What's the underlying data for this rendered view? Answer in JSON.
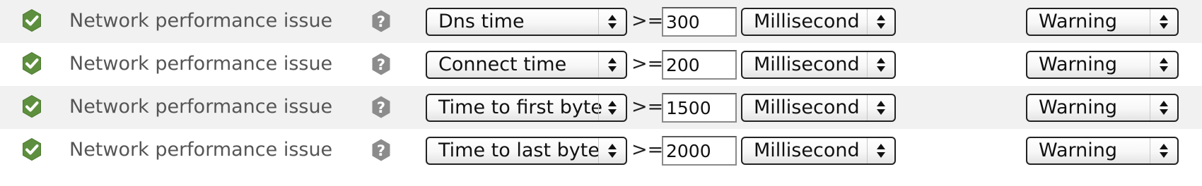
{
  "colors": {
    "ok_green": "#5e8f3e",
    "help_gray": "#8c8c8c",
    "row_stripe": "#f1f1f1"
  },
  "icons": {
    "status": "check-circle-icon",
    "help": "question-mark-icon",
    "select_arrows": "up-down-arrows-icon"
  },
  "rules": [
    {
      "issue": "Network performance issue",
      "metric": "Dns time",
      "operator": ">=",
      "threshold": "300",
      "unit": "Millisecond",
      "level": "Warning"
    },
    {
      "issue": "Network performance issue",
      "metric": "Connect time",
      "operator": ">=",
      "threshold": "200",
      "unit": "Millisecond",
      "level": "Warning"
    },
    {
      "issue": "Network performance issue",
      "metric": "Time to first byte",
      "operator": ">=",
      "threshold": "1500",
      "unit": "Millisecond",
      "level": "Warning"
    },
    {
      "issue": "Network performance issue",
      "metric": "Time to last byte",
      "operator": ">=",
      "threshold": "2000",
      "unit": "Millisecond",
      "level": "Warning"
    }
  ]
}
